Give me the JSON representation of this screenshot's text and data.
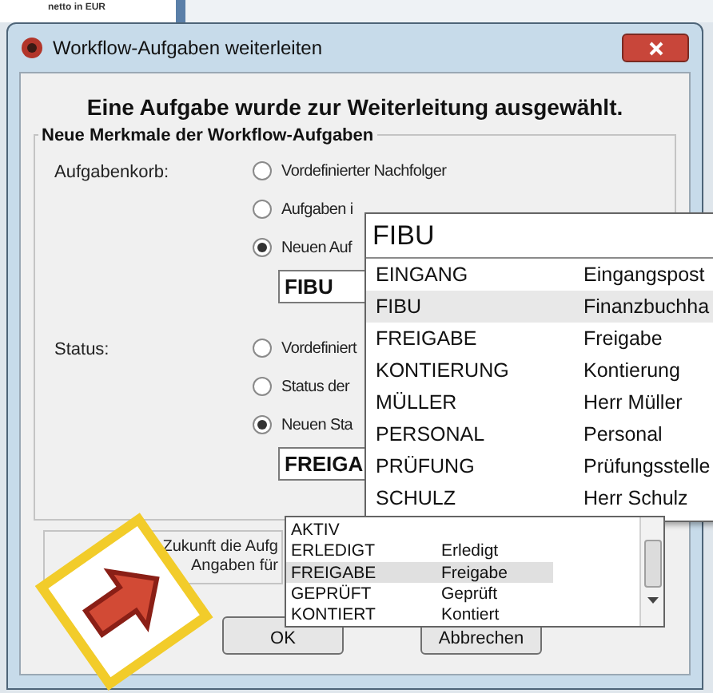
{
  "background": {
    "text": "netto in EUR"
  },
  "window": {
    "title": "Workflow-Aufgaben weiterleiten"
  },
  "headline": "Eine Aufgabe wurde zur Weiterleitung ausgewählt.",
  "group": {
    "title": "Neue Merkmale der Workflow-Aufgaben"
  },
  "sections": [
    {
      "label": "Aufgabenkorb:",
      "options": [
        {
          "label": "Vordefinierter Nachfolger",
          "selected": false
        },
        {
          "label": "Aufgaben i",
          "selected": false
        },
        {
          "label": "Neuen Auf",
          "selected": true
        }
      ],
      "combo": {
        "value": "FIBU"
      }
    },
    {
      "label": "Status:",
      "options": [
        {
          "label": "Vordefiniert",
          "selected": false
        },
        {
          "label": "Status der",
          "selected": false
        },
        {
          "label": "Neuen Sta",
          "selected": true
        }
      ],
      "combo": {
        "value": "FREIGA"
      }
    }
  ],
  "dropdowns": [
    {
      "filter": "FIBU",
      "items": [
        {
          "code": "EINGANG",
          "name": "Eingangspost",
          "selected": false
        },
        {
          "code": "FIBU",
          "name": "Finanzbuchha",
          "selected": true
        },
        {
          "code": "FREIGABE",
          "name": "Freigabe",
          "selected": false
        },
        {
          "code": "KONTIERUNG",
          "name": "Kontierung",
          "selected": false
        },
        {
          "code": "MÜLLER",
          "name": "Herr Müller",
          "selected": false
        },
        {
          "code": "PERSONAL",
          "name": "Personal",
          "selected": false
        },
        {
          "code": "PRÜFUNG",
          "name": "Prüfungsstelle",
          "selected": false
        },
        {
          "code": "SCHULZ",
          "name": "Herr Schulz",
          "selected": false
        }
      ]
    },
    {
      "items": [
        {
          "code": "AKTIV",
          "selected": false
        },
        {
          "code": "ERLEDIGT",
          "name": "Erledigt",
          "selected": false
        },
        {
          "code": "FREIGABE",
          "name": "Freigabe",
          "selected": true
        },
        {
          "code": "GEPRÜFT",
          "name": "Geprüft",
          "selected": false
        },
        {
          "code": "KONTIERT",
          "name": "Kontiert",
          "selected": false
        }
      ]
    }
  ],
  "notice": {
    "lines": [
      "Zukunft die Aufg",
      "Angaben für"
    ]
  },
  "buttons": [
    "OK",
    "Abbrechen"
  ]
}
